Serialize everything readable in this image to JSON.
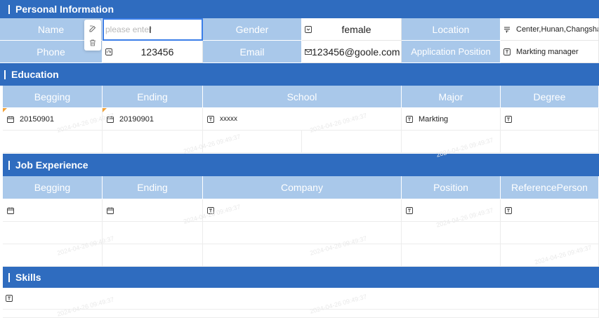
{
  "personal": {
    "section_title": "Personal Information",
    "name_label": "Name",
    "name_placeholder": "please enter",
    "gender_label": "Gender",
    "gender_value": "female",
    "location_label": "Location",
    "location_value": "Center,Hunan,Changsha",
    "phone_label": "Phone",
    "phone_value": "123456",
    "email_label": "Email",
    "email_value": "123456@goole.com",
    "position_label": "Application Position",
    "position_value": "Markting manager"
  },
  "education": {
    "section_title": "Education",
    "headers": [
      "Begging",
      "Ending",
      "School",
      "Major",
      "Degree"
    ],
    "row": {
      "begin": "20150901",
      "end": "20190901",
      "school": "xxxxx",
      "major": "Markting",
      "degree": ""
    }
  },
  "job": {
    "section_title": "Job Experience",
    "headers": [
      "Begging",
      "Ending",
      "Company",
      "Position",
      "ReferencePerson"
    ]
  },
  "skills": {
    "section_title": "Skills"
  },
  "watermark": "2024-04-26 09:49:37",
  "colors": {
    "section_bg": "#2f6cbf",
    "label_bg": "#a9c8ea",
    "input_border": "#3b7ee8",
    "corner_mark": "#f2a33a"
  }
}
